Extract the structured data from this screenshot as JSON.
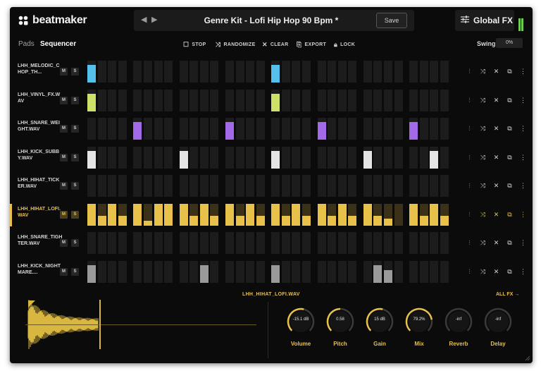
{
  "app": {
    "name": "beatmaker"
  },
  "preset": {
    "prev_icon": "◀",
    "next_icon": "▶",
    "name": "Genre Kit - Lofi Hip Hop 90 Bpm *",
    "save_label": "Save"
  },
  "global_fx": {
    "icon": "sliders-icon",
    "label": "Global FX"
  },
  "tabs": {
    "pads": "Pads",
    "sequencer": "Sequencer"
  },
  "toolbar": {
    "stop": "STOP",
    "randomize": "RANDOMIZE",
    "clear": "CLEAR",
    "export": "EXPORT",
    "lock": "LOCK"
  },
  "swing": {
    "label": "Swing",
    "value": "0%"
  },
  "colors": {
    "accent": "#e8c14a",
    "blue": "#55c0ea",
    "lime": "#cfe068",
    "purple": "#a26ae8",
    "white": "#e4e4e4",
    "gray": "#9a9a9a",
    "meter": "#6dcc52"
  },
  "tracks": [
    {
      "name": "LHH_MELODIC_CHOP_TH...",
      "mute": "M",
      "solo": "S",
      "color": "#55c0ea",
      "steps": [
        1,
        0,
        0,
        0,
        0,
        0,
        0,
        0,
        0,
        0,
        0,
        0,
        0,
        0,
        0,
        0,
        1,
        0,
        0,
        0,
        0,
        0,
        0,
        0,
        0,
        0,
        0,
        0,
        0,
        0,
        0,
        0
      ]
    },
    {
      "name": "LHH_VINYL_FX.WAV",
      "mute": "M",
      "solo": "S",
      "color": "#cfe068",
      "steps": [
        1,
        0,
        0,
        0,
        0,
        0,
        0,
        0,
        0,
        0,
        0,
        0,
        0,
        0,
        0,
        0,
        1,
        0,
        0,
        0,
        0,
        0,
        0,
        0,
        0,
        0,
        0,
        0,
        0,
        0,
        0,
        0
      ]
    },
    {
      "name": "LHH_SNARE_WEIGHT.WAV",
      "mute": "M",
      "solo": "S",
      "color": "#a26ae8",
      "steps": [
        0,
        0,
        0,
        0,
        1,
        0,
        0,
        0,
        0,
        0,
        0,
        0,
        1,
        0,
        0,
        0,
        0,
        0,
        0,
        0,
        1,
        0,
        0,
        0,
        0,
        0,
        0,
        0,
        1,
        0,
        0,
        0
      ]
    },
    {
      "name": "LHH_KICK_SUBBY.WAV",
      "mute": "M",
      "solo": "S",
      "color": "#e4e4e4",
      "steps": [
        1,
        0,
        0,
        0,
        0,
        0,
        0,
        0,
        1,
        0,
        0,
        0,
        0,
        0,
        0,
        0,
        1,
        0,
        0,
        0,
        0,
        0,
        0,
        0,
        1,
        0,
        0,
        0,
        0,
        0,
        1,
        0
      ]
    },
    {
      "name": "LHH_HIHAT_TICKER.WAV",
      "mute": "M",
      "solo": "S",
      "color": "#e4e4e4",
      "steps": [
        0,
        0,
        0,
        0,
        0,
        0,
        0,
        0,
        0,
        0,
        0,
        0,
        0,
        0,
        0,
        0,
        0,
        0,
        0,
        0,
        0,
        0,
        0,
        0,
        0,
        0,
        0,
        0,
        0,
        0,
        0,
        0
      ]
    },
    {
      "name": "LHH_HIHAT_LOFI.WAV",
      "mute": "M",
      "solo": "S",
      "color": "#e8c14a",
      "active": true,
      "steps": [
        1,
        0.45,
        1,
        0.45,
        1,
        0.2,
        1,
        1,
        1,
        0.45,
        1,
        0.45,
        1,
        0.45,
        1,
        0.45,
        1,
        0.45,
        1,
        0.45,
        1,
        0.45,
        1,
        0.45,
        1,
        0.45,
        0.3,
        0,
        1,
        0.45,
        1,
        0.45
      ]
    },
    {
      "name": "LHH_SNARE_TIGHTER.WAV",
      "mute": "M",
      "solo": "S",
      "color": "#9a9a9a",
      "steps": [
        0,
        0,
        0,
        0,
        0,
        0,
        0,
        0,
        0,
        0,
        0,
        0,
        0,
        0,
        0,
        0,
        0,
        0,
        0,
        0,
        0,
        0,
        0,
        0,
        0,
        0,
        0,
        0,
        0,
        0,
        0,
        0
      ]
    },
    {
      "name": "LHH_KICK_NIGHTMARE....",
      "mute": "M",
      "solo": "S",
      "color": "#9a9a9a",
      "steps": [
        1,
        0,
        0,
        0,
        0,
        0,
        0,
        0,
        0,
        0,
        1,
        0,
        0,
        0,
        0,
        0,
        1,
        0,
        0,
        0,
        0,
        0,
        0,
        0,
        0,
        1,
        0.55,
        0,
        0,
        0,
        0,
        0
      ]
    }
  ],
  "row_actions": [
    "bars-icon",
    "shuffle-icon",
    "close-icon",
    "copy-icon",
    "more-icon"
  ],
  "sample": {
    "name": "LHH_HIHAT_LOFI.WAV",
    "all_fx_label": "ALL FX"
  },
  "fx": [
    {
      "label": "Volume",
      "value": "-15.1 dB",
      "level": 0.55
    },
    {
      "label": "Pitch",
      "value": "0.58",
      "level": 0.5
    },
    {
      "label": "Gain",
      "value": "15 dB",
      "level": 0.55
    },
    {
      "label": "Mix",
      "value": "79.2%",
      "level": 0.8
    },
    {
      "label": "Reverb",
      "value": "-inf",
      "level": 0
    },
    {
      "label": "Delay",
      "value": "-inf",
      "level": 0
    }
  ]
}
